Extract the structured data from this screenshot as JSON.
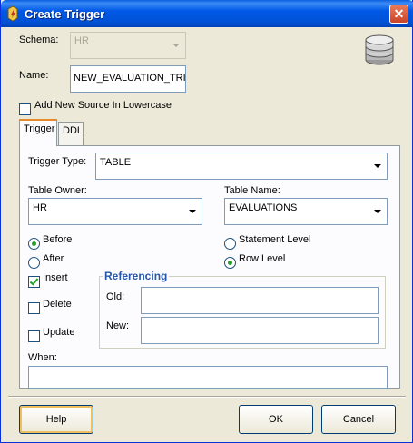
{
  "window": {
    "title": "Create Trigger",
    "close_label": "✕"
  },
  "schema": {
    "label": "Schema:",
    "value": "HR"
  },
  "name": {
    "label": "Name:",
    "value": "NEW_EVALUATION_TRIG"
  },
  "lowercase": {
    "label": "Add New Source In Lowercase",
    "checked": false
  },
  "tabs": [
    {
      "label": "Trigger",
      "active": true
    },
    {
      "label": "DDL",
      "active": false
    }
  ],
  "trigger": {
    "type_label": "Trigger Type:",
    "type_value": "TABLE",
    "owner_label": "Table Owner:",
    "owner_value": "HR",
    "table_label": "Table Name:",
    "table_value": "EVALUATIONS",
    "timing": [
      {
        "label": "Before",
        "selected": true
      },
      {
        "label": "After",
        "selected": false
      }
    ],
    "level": [
      {
        "label": "Statement Level",
        "selected": false
      },
      {
        "label": "Row Level",
        "selected": true
      }
    ],
    "events": [
      {
        "label": "Insert",
        "checked": true
      },
      {
        "label": "Delete",
        "checked": false
      },
      {
        "label": "Update",
        "checked": false
      }
    ],
    "referencing": {
      "title": "Referencing",
      "old_label": "Old:",
      "old_value": "",
      "new_label": "New:",
      "new_value": ""
    },
    "when_label": "When:",
    "when_value": ""
  },
  "buttons": {
    "help": "Help",
    "ok": "OK",
    "cancel": "Cancel"
  },
  "icons": {
    "title": "trigger-app-icon",
    "database": "database-icon"
  },
  "colors": {
    "titlebar": "#0054e3",
    "accent": "#2657a8",
    "check": "#21a121"
  }
}
